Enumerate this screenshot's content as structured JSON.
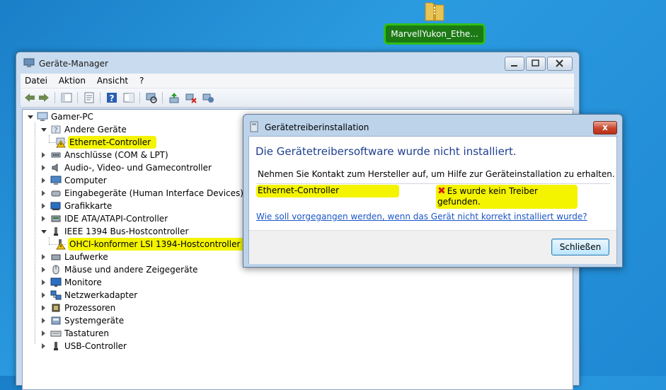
{
  "desktop": {
    "icon_label": "MarvellYukon_Ethe..."
  },
  "window": {
    "title": "Geräte-Manager",
    "menu": [
      "Datei",
      "Aktion",
      "Ansicht",
      "?"
    ],
    "tree": {
      "root": "Gamer-PC",
      "items": [
        {
          "label": "Andere Geräte",
          "expanded": true,
          "icon": "unknown-device-icon"
        },
        {
          "label": "Ethernet-Controller",
          "child": true,
          "icon": "warning-device-icon",
          "highlighted": true
        },
        {
          "label": "Anschlüsse (COM & LPT)",
          "icon": "port-icon"
        },
        {
          "label": "Audio-, Video- und Gamecontroller",
          "icon": "speaker-icon"
        },
        {
          "label": "Computer",
          "icon": "computer-icon"
        },
        {
          "label": "Eingabegeräte (Human Interface Devices)",
          "icon": "hid-icon"
        },
        {
          "label": "Grafikkarte",
          "icon": "display-adapter-icon"
        },
        {
          "label": "IDE ATA/ATAPI-Controller",
          "icon": "ide-icon"
        },
        {
          "label": "IEEE 1394 Bus-Hostcontroller",
          "expanded": true,
          "icon": "firewire-icon"
        },
        {
          "label": "OHCI-konformer LSI 1394-Hostcontroller",
          "child": true,
          "icon": "warning-device-icon",
          "highlighted": true
        },
        {
          "label": "Laufwerke",
          "icon": "drive-icon"
        },
        {
          "label": "Mäuse und andere Zeigegeräte",
          "icon": "mouse-icon"
        },
        {
          "label": "Monitore",
          "icon": "monitor-icon"
        },
        {
          "label": "Netzwerkadapter",
          "icon": "network-icon"
        },
        {
          "label": "Prozessoren",
          "icon": "cpu-icon"
        },
        {
          "label": "Systemgeräte",
          "icon": "system-icon"
        },
        {
          "label": "Tastaturen",
          "icon": "keyboard-icon"
        },
        {
          "label": "USB-Controller",
          "icon": "usb-icon"
        }
      ]
    }
  },
  "dialog": {
    "title": "Gerätetreiberinstallation",
    "close_label": "x",
    "heading": "Die Gerätetreibersoftware wurde nicht installiert.",
    "text": "Nehmen Sie Kontakt zum Hersteller auf, um Hilfe zur Geräteinstallation zu erhalten.",
    "device": "Ethernet-Controller",
    "error": "Es wurde kein Treiber gefunden.",
    "link": "Wie soll vorgegangen werden, wenn das Gerät nicht korrekt installiert wurde?",
    "button": "Schließen"
  },
  "colors": {
    "highlight": "#f4f400",
    "desktop_label_highlight": "#2fbe18",
    "heading": "#1e3e8f",
    "link": "#1a55c8"
  }
}
